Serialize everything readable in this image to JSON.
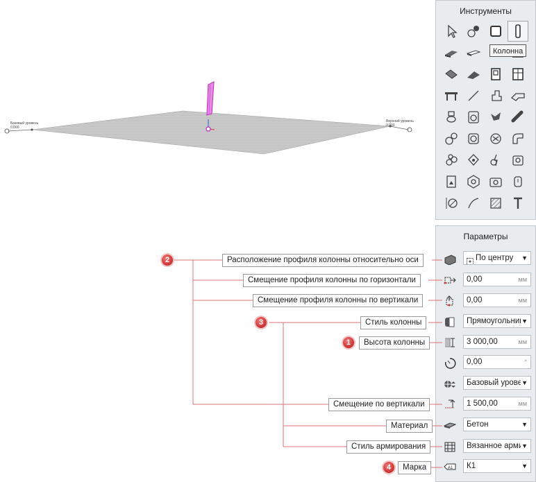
{
  "tools_panel": {
    "title": "Инструменты",
    "tooltip": "Колонна",
    "tools": [
      "select-arrow-icon",
      "shapes-icon",
      "wall-icon",
      "column-icon",
      "slab-icon",
      "beam-icon",
      "foundation-icon",
      "stair-icon",
      "roof-icon",
      "ramp-icon",
      "door-icon",
      "window-icon",
      "railing-icon",
      "line-icon",
      "equipment-icon",
      "duct-icon",
      "sanitary-icon",
      "washer-icon",
      "pipe-fitting-icon",
      "pipe-icon",
      "hydrant-icon",
      "fan-icon",
      "valve-icon",
      "duct-elbow-icon",
      "pump-icon",
      "lamp-icon",
      "electric-icon",
      "socket-icon",
      "panel-icon",
      "sensor-icon",
      "camera-icon",
      "switch-icon",
      "dimension-icon",
      "curve-icon",
      "hatch-icon",
      "text-icon"
    ]
  },
  "params_panel": {
    "title": "Параметры",
    "rows": [
      {
        "icon": "profile-placement-icon",
        "value": "По центру",
        "unit": "",
        "dropdown": true
      },
      {
        "icon": "horizontal-offset-icon",
        "value": "0,00",
        "unit": "мм",
        "dropdown": false
      },
      {
        "icon": "vertical-offset-icon",
        "value": "0,00",
        "unit": "мм",
        "dropdown": false
      },
      {
        "icon": "column-style-icon",
        "value": "Прямоугольник",
        "unit": "",
        "dropdown": true
      },
      {
        "icon": "column-height-icon",
        "value": "3 000,00",
        "unit": "мм",
        "dropdown": false
      },
      {
        "icon": "rotation-icon",
        "value": "0,00",
        "unit": "°",
        "dropdown": false
      },
      {
        "icon": "base-level-icon",
        "value": "Базовый уровень",
        "unit": "",
        "dropdown": true
      },
      {
        "icon": "elevation-offset-icon",
        "value": "1 500,00",
        "unit": "мм",
        "dropdown": false
      },
      {
        "icon": "material-icon",
        "value": "Бетон",
        "unit": "",
        "dropdown": true
      },
      {
        "icon": "reinforcement-icon",
        "value": "Вязанное армирование",
        "unit": "",
        "dropdown": true
      },
      {
        "icon": "mark-icon",
        "value": "К1",
        "unit": "",
        "dropdown": true
      }
    ]
  },
  "annotations": {
    "profile_placement": "Расположение профиля колонны относительно оси",
    "horizontal_offset": "Смещение профиля колонны по горизонтали",
    "vertical_offset": "Смещение профиля колонны по вертикали",
    "column_style": "Стиль колонны",
    "column_height": "Высота колонны",
    "elevation_offset": "Смещение по вертикали",
    "material": "Материал",
    "reinforcement_style": "Стиль армирования",
    "mark": "Марка"
  },
  "badges": {
    "b1": "1",
    "b2": "2",
    "b3": "3",
    "b4": "4"
  },
  "viewport": {
    "left_level_label": "Базовый уровень",
    "left_level_value": "0,000",
    "right_level_label": "Верхний уровень",
    "right_level_value": "3,000"
  },
  "colors": {
    "accent": "#d33838",
    "column": "#e04ee0",
    "leader": "#e07070"
  }
}
